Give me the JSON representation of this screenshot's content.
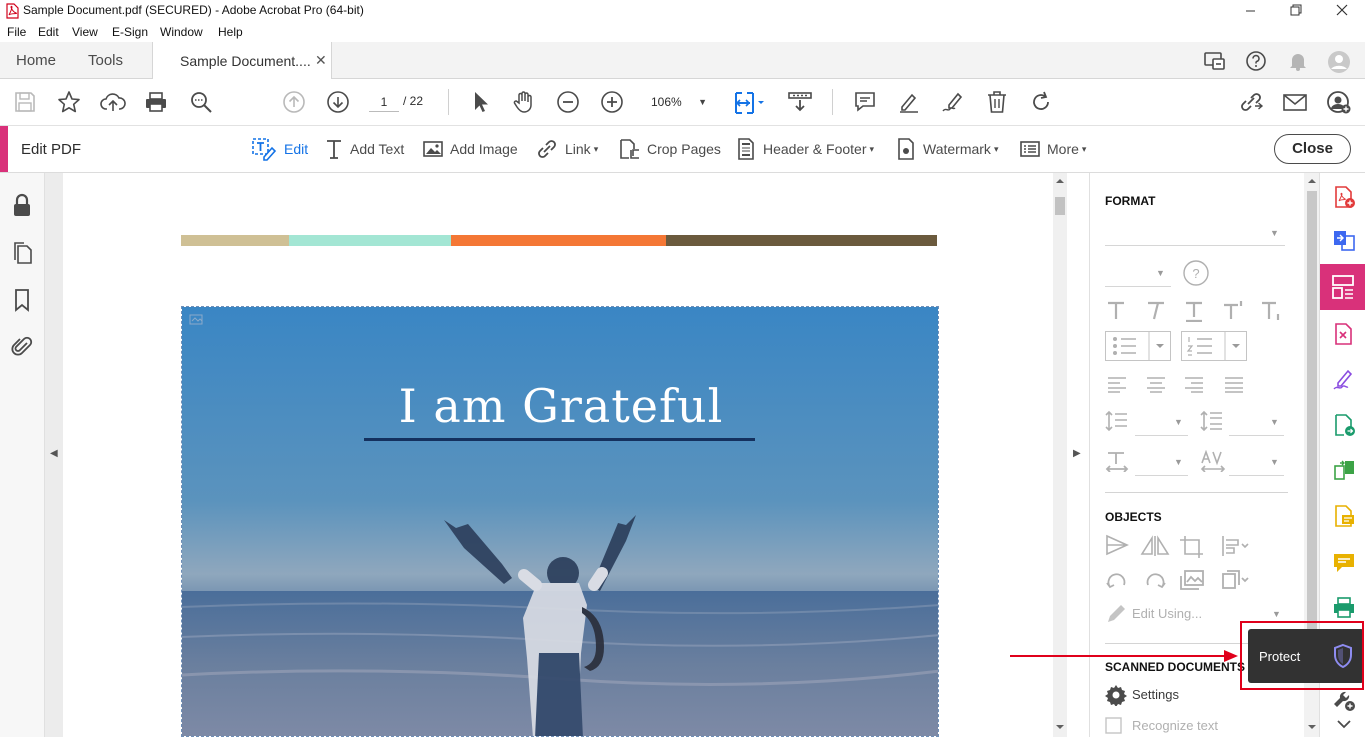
{
  "window": {
    "title": "Sample Document.pdf (SECURED) - Adobe Acrobat Pro (64-bit)",
    "controls": [
      "minimize-icon",
      "restore-icon",
      "close-icon"
    ]
  },
  "menu": {
    "items": [
      "File",
      "Edit",
      "View",
      "E-Sign",
      "Window",
      "Help"
    ]
  },
  "tabs": {
    "home": "Home",
    "tools": "Tools",
    "document": "Sample Document....",
    "close_glyph": "✕"
  },
  "toolbar": {
    "page_current": "1",
    "page_total": "/ 22",
    "zoom": "106%"
  },
  "editbar": {
    "title": "Edit PDF",
    "edit": "Edit",
    "add_text": "Add Text",
    "add_image": "Add Image",
    "link": "Link",
    "crop_pages": "Crop Pages",
    "header_footer": "Header & Footer",
    "watermark": "Watermark",
    "more": "More",
    "close": "Close",
    "caret": "▾"
  },
  "document": {
    "stripe_colors": [
      "#cfc095",
      "#a3e6d4",
      "#f47735",
      "#6b5a3d"
    ],
    "photo_title": "I am Grateful"
  },
  "panel": {
    "format_heading": "FORMAT",
    "objects_heading": "OBJECTS",
    "edit_using": "Edit Using...",
    "scanned_heading": "SCANNED DOCUMENTS",
    "settings": "Settings",
    "recognize_text": "Recognize text",
    "help_glyph": "?"
  },
  "tooltip": {
    "label": "Protect"
  },
  "colors": {
    "accent": "#d9317a",
    "active_blue": "#1473e6",
    "annotation_red": "#e0001b"
  }
}
